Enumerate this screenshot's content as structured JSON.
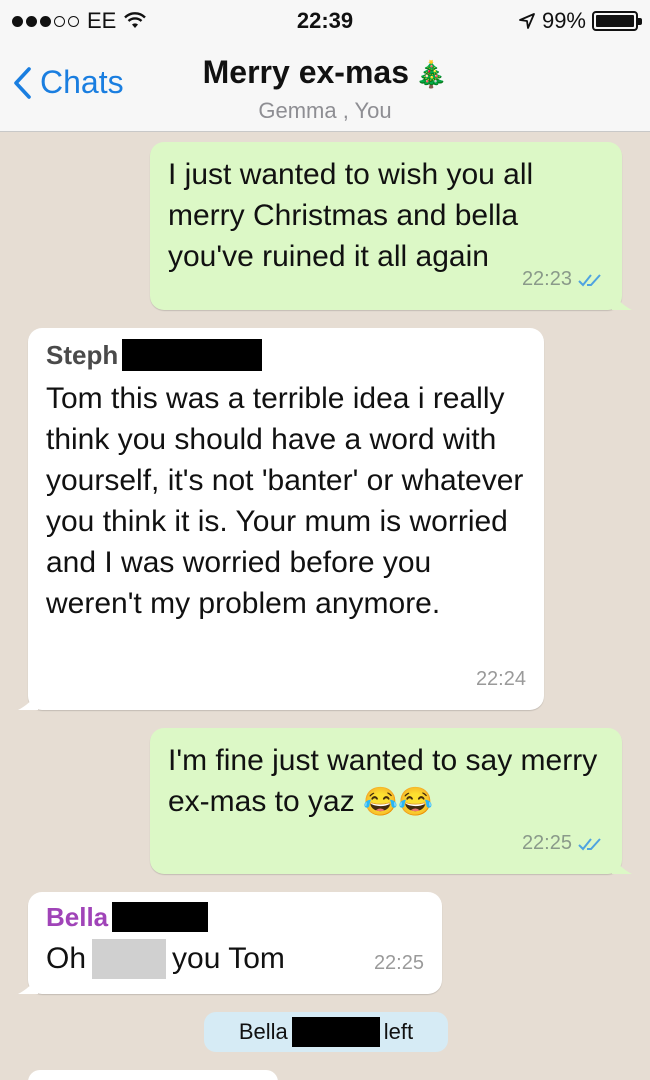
{
  "status_bar": {
    "carrier": "EE",
    "time": "22:39",
    "battery": "99%",
    "battery_level": 0.99
  },
  "header": {
    "back_label": "Chats",
    "title": "Merry ex-mas",
    "title_emoji": "🎄",
    "subtitle": "Gemma , You"
  },
  "messages": [
    {
      "direction": "outgoing",
      "text": "I just wanted to wish you all merry Christmas and bella you've ruined it all again",
      "time": "22:23",
      "read": true
    },
    {
      "direction": "incoming",
      "sender": "Steph",
      "sender_color": "#4a4a4a",
      "text": "Tom this was a terrible idea i really think you should have a word with yourself, it's not 'banter' or whatever you think it is. Your mum is worried and I was worried before you weren't my problem anymore.",
      "time": "22:24"
    },
    {
      "direction": "outgoing",
      "text": "I'm fine just wanted to say merry ex-mas to yaz",
      "emoji": "😂😂",
      "time": "22:25",
      "read": true
    },
    {
      "direction": "incoming",
      "sender": "Bella",
      "sender_color": "#a044b8",
      "text_before": "Oh",
      "text_after": "you Tom",
      "time": "22:25"
    }
  ],
  "system": {
    "before": "Bella",
    "after": "left"
  },
  "colors": {
    "outgoing_bubble": "#dcf8c6",
    "incoming_bubble": "#ffffff",
    "accent": "#1a7ee0",
    "read_ticks": "#4fa3e0",
    "chat_background": "#e6ddd3"
  }
}
